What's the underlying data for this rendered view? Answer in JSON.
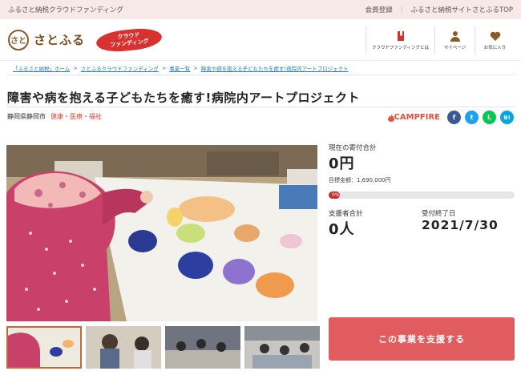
{
  "topbar": {
    "site_name": "ふるさと納税クラウドファンディング",
    "member": "会員登録",
    "site_top": "ふるさと納税サイトさとふるTOP"
  },
  "header": {
    "logo_mark": "さと",
    "logo_text": "さとふる",
    "badge_line1": "クラウド",
    "badge_line2": "ファンディング",
    "nav": [
      {
        "label": "クラウドファンディングとは",
        "icon": "book-icon"
      },
      {
        "label": "マイページ",
        "icon": "person-icon"
      },
      {
        "label": "お気に入り",
        "icon": "heart-icon"
      }
    ]
  },
  "breadcrumb": {
    "items": [
      "「ふるさと納税」ホーム",
      "さとふるクラウドファンディング",
      "事業一覧",
      "障害や病を抱える子どもたちを癒す!病院内アートプロジェクト"
    ],
    "separator": ">"
  },
  "project": {
    "title": "障害や病を抱える子どもたちを癒す!病院内アートプロジェクト",
    "location": "静岡県静岡市",
    "category": "健康・医療・福祉"
  },
  "share": {
    "partner": "CAMPFIRE",
    "buttons": [
      {
        "label": "f",
        "color": "#3b5998",
        "icon": "facebook-icon"
      },
      {
        "label": "t",
        "color": "#1da1f2",
        "icon": "twitter-icon"
      },
      {
        "label": "L",
        "color": "#06c755",
        "icon": "line-icon"
      },
      {
        "label": "B!",
        "color": "#00a4de",
        "icon": "hatena-icon"
      }
    ]
  },
  "funding": {
    "current_label": "現在の寄付合計",
    "current_amount": "0円",
    "goal": "目標金額：1,690,000円",
    "progress_percent": 0,
    "progress_text": "0%",
    "supporters_label": "支援者合計",
    "supporters": "0人",
    "deadline_label": "受付終了日",
    "deadline": "2021/7/30",
    "support_button": "この事業を支援する"
  },
  "colors": {
    "accent": "#e05c5f",
    "progress": "#c82c2c",
    "category": "#d84a3a",
    "link": "#2a7ab8"
  }
}
